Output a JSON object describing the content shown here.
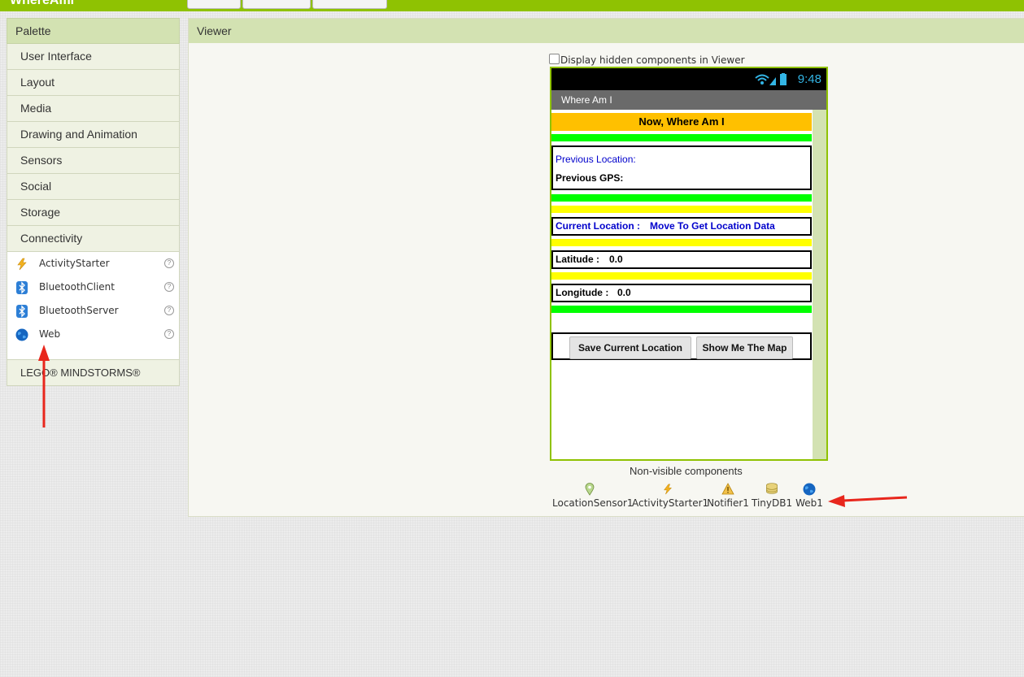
{
  "app": {
    "title": "WhereAmI"
  },
  "palette": {
    "header": "Palette",
    "categories": [
      "User Interface",
      "Layout",
      "Media",
      "Drawing and Animation",
      "Sensors",
      "Social",
      "Storage",
      "Connectivity"
    ],
    "components": [
      {
        "label": "ActivityStarter",
        "icon": "lightning-icon"
      },
      {
        "label": "BluetoothClient",
        "icon": "bluetooth-icon"
      },
      {
        "label": "BluetoothServer",
        "icon": "bluetooth-icon"
      },
      {
        "label": "Web",
        "icon": "globe-icon"
      }
    ],
    "help_glyph": "?",
    "lego": "LEGO® MINDSTORMS®"
  },
  "viewer": {
    "header": "Viewer",
    "hidden_toggle_label": "Display hidden components in Viewer",
    "phone": {
      "time": "9:48",
      "screen_title": "Where Am I",
      "heading": "Now, Where Am I",
      "prev_location_label": "Previous Location:",
      "prev_gps_label": "Previous GPS:",
      "current_location_label": "Current Location :",
      "current_location_value": "Move To Get Location Data",
      "latitude_label": "Latitude :",
      "latitude_value": "0.0",
      "longitude_label": "Longitude :",
      "longitude_value": "0.0",
      "save_button": "Save Current Location",
      "map_button": "Show Me The Map"
    },
    "nonvisible_title": "Non-visible components",
    "nonvisible": [
      {
        "label": "LocationSensor1",
        "icon": "location-pin-icon"
      },
      {
        "label": "ActivityStarter1",
        "icon": "lightning-icon"
      },
      {
        "label": "Notifier1",
        "icon": "warning-icon"
      },
      {
        "label": "TinyDB1",
        "icon": "database-icon"
      },
      {
        "label": "Web1",
        "icon": "globe-icon"
      }
    ]
  },
  "colors": {
    "topbar": "#8fc202",
    "header_green": "#d3e2b2",
    "heading_bg": "#ffc000",
    "band_green": "#00ff00",
    "band_yellow": "#ffff00",
    "blue_text": "#0000cc",
    "annotation_red": "#e8261c"
  }
}
